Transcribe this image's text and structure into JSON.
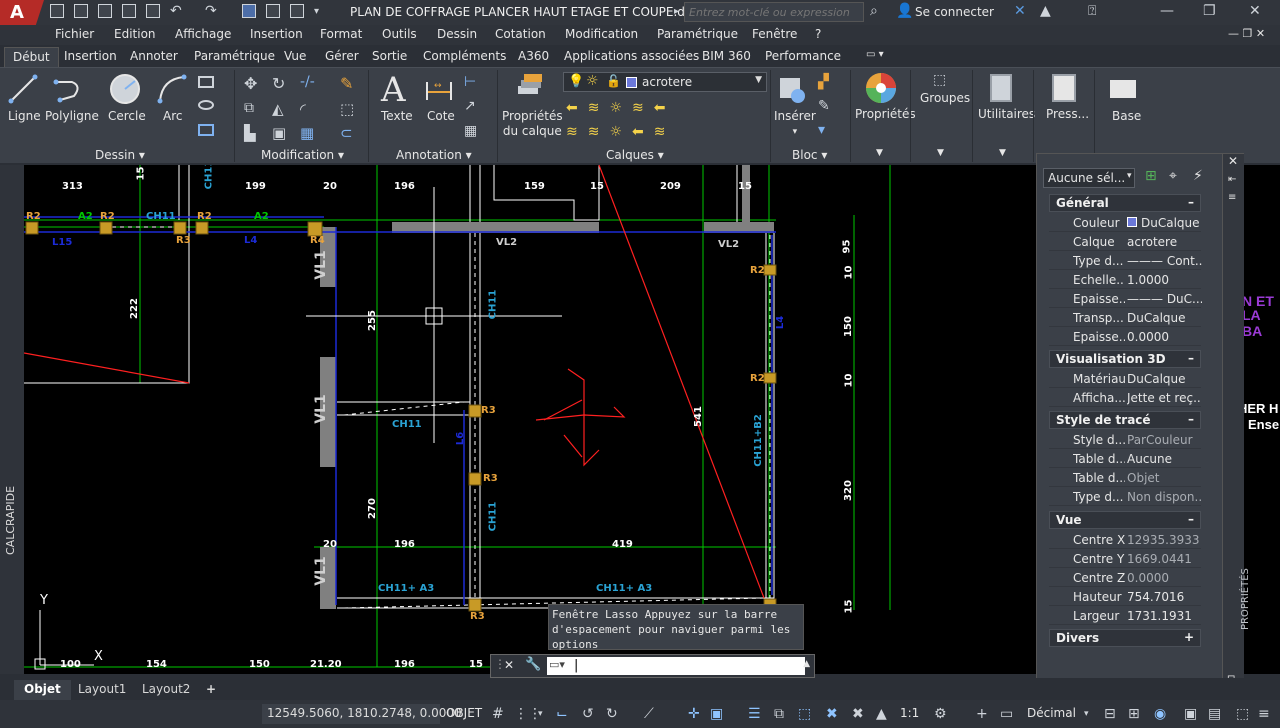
{
  "app": {
    "logo_letter": "A",
    "document_title": "PLAN DE COFFRAGE PLANCER HAUT ETAGE ET COUPE.dwg"
  },
  "search": {
    "placeholder": "Entrez mot-clé ou expression"
  },
  "account": {
    "signin": "Se connecter"
  },
  "menubar": [
    "Fichier",
    "Edition",
    "Affichage",
    "Insertion",
    "Format",
    "Outils",
    "Dessin",
    "Cotation",
    "Modification",
    "Paramétrique",
    "Fenêtre",
    "?"
  ],
  "ribbon_tabs": [
    "Début",
    "Insertion",
    "Annoter",
    "Paramétrique",
    "Vue",
    "Gérer",
    "Sortie",
    "Compléments",
    "A360",
    "Applications associées",
    "BIM 360",
    "Performance"
  ],
  "ribbon": {
    "draw": {
      "title": "Dessin",
      "ligne": "Ligne",
      "polyligne": "Polyligne",
      "cercle": "Cercle",
      "arc": "Arc"
    },
    "modify": {
      "title": "Modification"
    },
    "annotation": {
      "title": "Annotation",
      "texte": "Texte",
      "cote": "Cote"
    },
    "layers": {
      "title": "Calques",
      "props_line1": "Propriétés",
      "props_line2": "du calque",
      "current_layer": "acrotere"
    },
    "block": {
      "title": "Bloc",
      "inserer": "Insérer"
    },
    "proprietes": "Propriétés",
    "groupes": "Groupes",
    "utilitaires": "Utilitaires",
    "presse": "Press...",
    "base": "Base"
  },
  "left_strip": {
    "label": "CALCRAPIDE"
  },
  "drawing": {
    "dims_top": [
      "313",
      "15",
      "199",
      "20",
      "196",
      "159",
      "15",
      "209",
      "15"
    ],
    "dims_bottom": [
      "100",
      "154",
      "150",
      "21.20",
      "196",
      "15"
    ],
    "dims_mid": [
      "196",
      "419",
      "20"
    ],
    "vertical_dims": [
      "222",
      "255",
      "270",
      "541",
      "95",
      "10",
      "150",
      "10",
      "320",
      "15"
    ],
    "labels": {
      "r2": "R2",
      "r3": "R3",
      "r4": "R4",
      "a2": "A2",
      "ch11": "CH11",
      "l15": "L15",
      "l4": "L4",
      "vl2": "VL2",
      "vl1": "VL1",
      "ch11b2": "CH11+B2",
      "ch11a3": "CH11+ A3",
      "y": "Y",
      "x": "X",
      "l6": "L6"
    },
    "side_fragments": [
      "N ET",
      "LA BA",
      "HER H",
      "Ense"
    ]
  },
  "properties": {
    "selection": "Aucune sél...",
    "sections": {
      "general": "Général",
      "visu3d": "Visualisation 3D",
      "plot": "Style de tracé",
      "view": "Vue",
      "misc": "Divers"
    },
    "general": [
      {
        "k": "Couleur",
        "v": "DuCalque"
      },
      {
        "k": "Calque",
        "v": "acrotere"
      },
      {
        "k": "Type d...",
        "v": "——— Cont..."
      },
      {
        "k": "Echelle...",
        "v": "1.0000"
      },
      {
        "k": "Epaisse...",
        "v": "——— DuC..."
      },
      {
        "k": "Transp...",
        "v": "DuCalque"
      },
      {
        "k": "Epaisse...",
        "v": "0.0000"
      }
    ],
    "visu3d": [
      {
        "k": "Matériau",
        "v": "DuCalque"
      },
      {
        "k": "Afficha...",
        "v": "Jette et reç..."
      }
    ],
    "plot": [
      {
        "k": "Style d...",
        "v": "ParCouleur"
      },
      {
        "k": "Table d...",
        "v": "Aucune"
      },
      {
        "k": "Table d...",
        "v": "Objet"
      },
      {
        "k": "Type d...",
        "v": "Non dispon..."
      }
    ],
    "view": [
      {
        "k": "Centre X",
        "v": "12935.3933"
      },
      {
        "k": "Centre Y",
        "v": "1669.0441"
      },
      {
        "k": "Centre Z",
        "v": "0.0000"
      },
      {
        "k": "Hauteur",
        "v": "754.7016"
      },
      {
        "k": "Largeur",
        "v": "1731.1931"
      }
    ],
    "palette_label": "PROPRIÉTÉS"
  },
  "command": {
    "tooltip": "Fenêtre Lasso Appuyez sur la barre d'espacement pour naviguer parmi les options"
  },
  "layout_tabs": [
    "Objet",
    "Layout1",
    "Layout2"
  ],
  "status": {
    "coords": "12549.5060, 1810.2748, 0.0000",
    "mode": "OBJET",
    "scale": "1:1",
    "units": "Décimal"
  },
  "colors": {
    "accent_red": "#b52b27",
    "layer_swatch": "#6b78d9",
    "wall_gray": "#808080",
    "green": "#00c800",
    "blue": "#1c2bd6",
    "cyan": "#2aa3d4"
  }
}
